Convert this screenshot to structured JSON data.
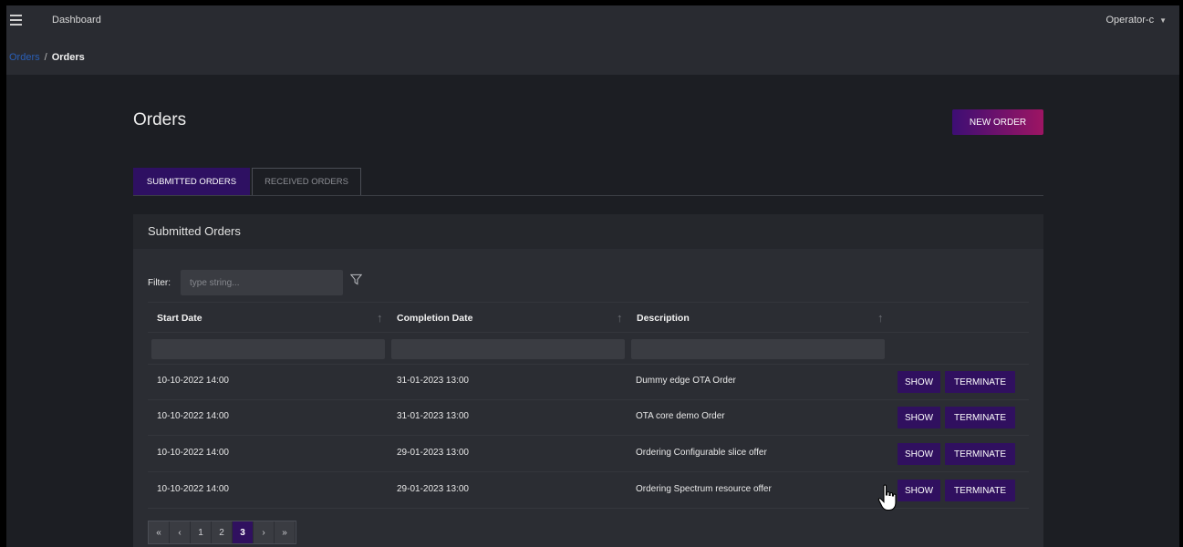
{
  "header": {
    "nav_label": "Dashboard",
    "user": "Operator-c",
    "breadcrumb": {
      "link": "Orders",
      "separator": "/",
      "current": "Orders"
    }
  },
  "page": {
    "title": "Orders",
    "new_order_label": "NEW ORDER",
    "tabs": [
      {
        "label": "SUBMITTED ORDERS",
        "active": true
      },
      {
        "label": "RECEIVED ORDERS",
        "active": false
      }
    ]
  },
  "card": {
    "title": "Submitted Orders",
    "filter_label": "Filter:",
    "filter_placeholder": "type string...",
    "columns": [
      "Start Date",
      "Completion Date",
      "Description"
    ],
    "rows": [
      {
        "start": "10-10-2022 14:00",
        "completion": "31-01-2023 13:00",
        "description": "Dummy edge OTA Order"
      },
      {
        "start": "10-10-2022 14:00",
        "completion": "31-01-2023 13:00",
        "description": "OTA core demo Order"
      },
      {
        "start": "10-10-2022 14:00",
        "completion": "29-01-2023 13:00",
        "description": "Ordering Configurable slice offer"
      },
      {
        "start": "10-10-2022 14:00",
        "completion": "29-01-2023 13:00",
        "description": "Ordering Spectrum resource offer"
      }
    ],
    "show_label": "SHOW",
    "terminate_label": "TERMINATE",
    "pagination": {
      "first": "«",
      "prev": "‹",
      "pages": [
        "1",
        "2",
        "3"
      ],
      "next": "›",
      "last": "»",
      "current": "3"
    }
  }
}
